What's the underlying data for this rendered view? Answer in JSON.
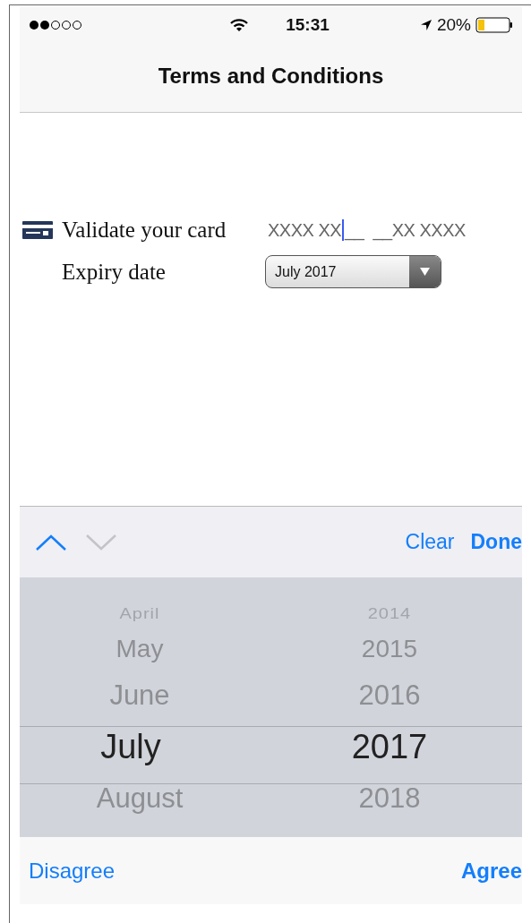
{
  "status_bar": {
    "time": "15:31",
    "battery": "20%"
  },
  "nav_bar": {
    "title": "Terms and Conditions"
  },
  "form": {
    "card": {
      "label": "Validate your card",
      "value": "XXXX XX",
      "mask": "__  __XX XXXX"
    },
    "expiry": {
      "label": "Expiry date",
      "value": "July 2017"
    }
  },
  "toolbar": {
    "previous": {
      "disabled": false
    },
    "next": {
      "disabled": true
    },
    "buttons": [
      {
        "label": "Clear",
        "kind": "plain"
      },
      {
        "label": "Done",
        "kind": "bold"
      }
    ]
  },
  "picker": {
    "columns": [
      {
        "items": [
          {
            "label": "April",
            "selected": false
          },
          {
            "label": "May",
            "selected": false
          },
          {
            "label": "June",
            "selected": false
          },
          {
            "label": "July",
            "selected": true
          },
          {
            "label": "August",
            "selected": false
          }
        ]
      },
      {
        "items": [
          {
            "label": "2014",
            "selected": false
          },
          {
            "label": "2015",
            "selected": false
          },
          {
            "label": "2016",
            "selected": false
          },
          {
            "label": "2017",
            "selected": true
          },
          {
            "label": "2018",
            "selected": false
          }
        ]
      }
    ]
  },
  "bottom_bar": {
    "buttons": [
      {
        "label": "Disagree",
        "kind": "plain"
      },
      {
        "label": "Agree",
        "kind": "bold"
      }
    ]
  }
}
